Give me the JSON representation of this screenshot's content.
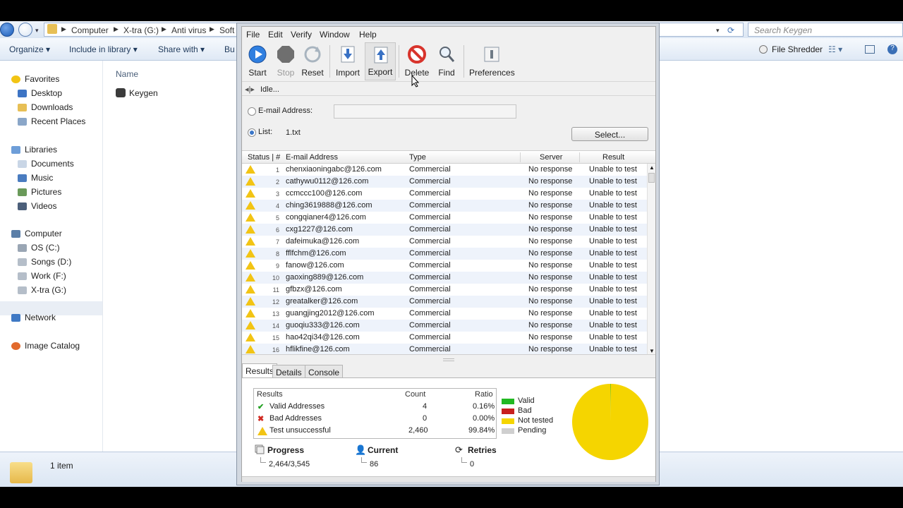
{
  "explorer": {
    "breadcrumb": [
      "Computer",
      "X-tra (G:)",
      "Anti virus",
      "Soft"
    ],
    "search_placeholder": "Search Keygen",
    "commands": [
      "Organize ▾",
      "Include in library ▾",
      "Share with ▾",
      "Bu"
    ],
    "file_shredder": "File Shredder",
    "nav": {
      "favorites": "Favorites",
      "desktop": "Desktop",
      "downloads": "Downloads",
      "recent": "Recent Places",
      "libraries": "Libraries",
      "documents": "Documents",
      "music": "Music",
      "pictures": "Pictures",
      "videos": "Videos",
      "computer": "Computer",
      "os": "OS (C:)",
      "songs": "Songs (D:)",
      "work": "Work (F:)",
      "xtra": "X-tra (G:)",
      "network": "Network",
      "catalog": "Image Catalog"
    },
    "column_name": "Name",
    "file": "Keygen",
    "item_count": "1 item"
  },
  "app": {
    "menu": [
      "File",
      "Edit",
      "Verify",
      "Window",
      "Help"
    ],
    "toolbar": {
      "start": "Start",
      "stop": "Stop",
      "reset": "Reset",
      "import": "Import",
      "export": "Export",
      "delete": "Delete",
      "find": "Find",
      "preferences": "Preferences"
    },
    "status": "Idle...",
    "email_label": "E-mail Address:",
    "email_value": "",
    "list_label": "List:",
    "list_value": "1.txt",
    "select_btn": "Select...",
    "columns": {
      "status": "Status | #",
      "email": "E-mail Address",
      "type": "Type",
      "server": "Server",
      "result": "Result"
    },
    "rows": [
      {
        "n": "1",
        "email": "chenxiaoningabc@126.com",
        "type": "Commercial",
        "server": "No response",
        "result": "Unable to test"
      },
      {
        "n": "2",
        "email": "cathywu0112@126.com",
        "type": "Commercial",
        "server": "No response",
        "result": "Unable to test"
      },
      {
        "n": "3",
        "email": "ccmccc100@126.com",
        "type": "Commercial",
        "server": "No response",
        "result": "Unable to test"
      },
      {
        "n": "4",
        "email": "ching3619888@126.com",
        "type": "Commercial",
        "server": "No response",
        "result": "Unable to test"
      },
      {
        "n": "5",
        "email": "congqianer4@126.com",
        "type": "Commercial",
        "server": "No response",
        "result": "Unable to test"
      },
      {
        "n": "6",
        "email": "cxg1227@126.com",
        "type": "Commercial",
        "server": "No response",
        "result": "Unable to test"
      },
      {
        "n": "7",
        "email": "dafeimuka@126.com",
        "type": "Commercial",
        "server": "No response",
        "result": "Unable to test"
      },
      {
        "n": "8",
        "email": "fflfchm@126.com",
        "type": "Commercial",
        "server": "No response",
        "result": "Unable to test"
      },
      {
        "n": "9",
        "email": "fanow@126.com",
        "type": "Commercial",
        "server": "No response",
        "result": "Unable to test"
      },
      {
        "n": "10",
        "email": "gaoxing889@126.com",
        "type": "Commercial",
        "server": "No response",
        "result": "Unable to test"
      },
      {
        "n": "11",
        "email": "gfbzx@126.com",
        "type": "Commercial",
        "server": "No response",
        "result": "Unable to test"
      },
      {
        "n": "12",
        "email": "greatalker@126.com",
        "type": "Commercial",
        "server": "No response",
        "result": "Unable to test"
      },
      {
        "n": "13",
        "email": "guangjing2012@126.com",
        "type": "Commercial",
        "server": "No response",
        "result": "Unable to test"
      },
      {
        "n": "14",
        "email": "guoqiu333@126.com",
        "type": "Commercial",
        "server": "No response",
        "result": "Unable to test"
      },
      {
        "n": "15",
        "email": "hao42qi34@126.com",
        "type": "Commercial",
        "server": "No response",
        "result": "Unable to test"
      },
      {
        "n": "16",
        "email": "hflikfine@126.com",
        "type": "Commercial",
        "server": "No response",
        "result": "Unable to test"
      }
    ],
    "tabs": [
      "Results",
      "Details",
      "Console"
    ],
    "results": {
      "h_results": "Results",
      "h_count": "Count",
      "h_ratio": "Ratio",
      "valid": {
        "label": "Valid Addresses",
        "count": "4",
        "ratio": "0.16%"
      },
      "bad": {
        "label": "Bad Addresses",
        "count": "0",
        "ratio": "0.00%"
      },
      "unsuccessful": {
        "label": "Test unsuccessful",
        "count": "2,460",
        "ratio": "99.84%"
      }
    },
    "legend": {
      "valid": "Valid",
      "bad": "Bad",
      "not_tested": "Not tested",
      "pending": "Pending",
      "colors": {
        "valid": "#22b822",
        "bad": "#c8201e",
        "not_tested": "#f5d500",
        "pending": "#cfcfcf"
      }
    },
    "progress": {
      "label": "Progress",
      "value": "2,464/3,545"
    },
    "current": {
      "label": "Current",
      "value": "86"
    },
    "retries": {
      "label": "Retries",
      "value": "0"
    }
  },
  "chart_data": {
    "type": "pie",
    "categories": [
      "Valid",
      "Bad",
      "Not tested",
      "Pending"
    ],
    "values": [
      0.16,
      0,
      99.84,
      0
    ]
  }
}
